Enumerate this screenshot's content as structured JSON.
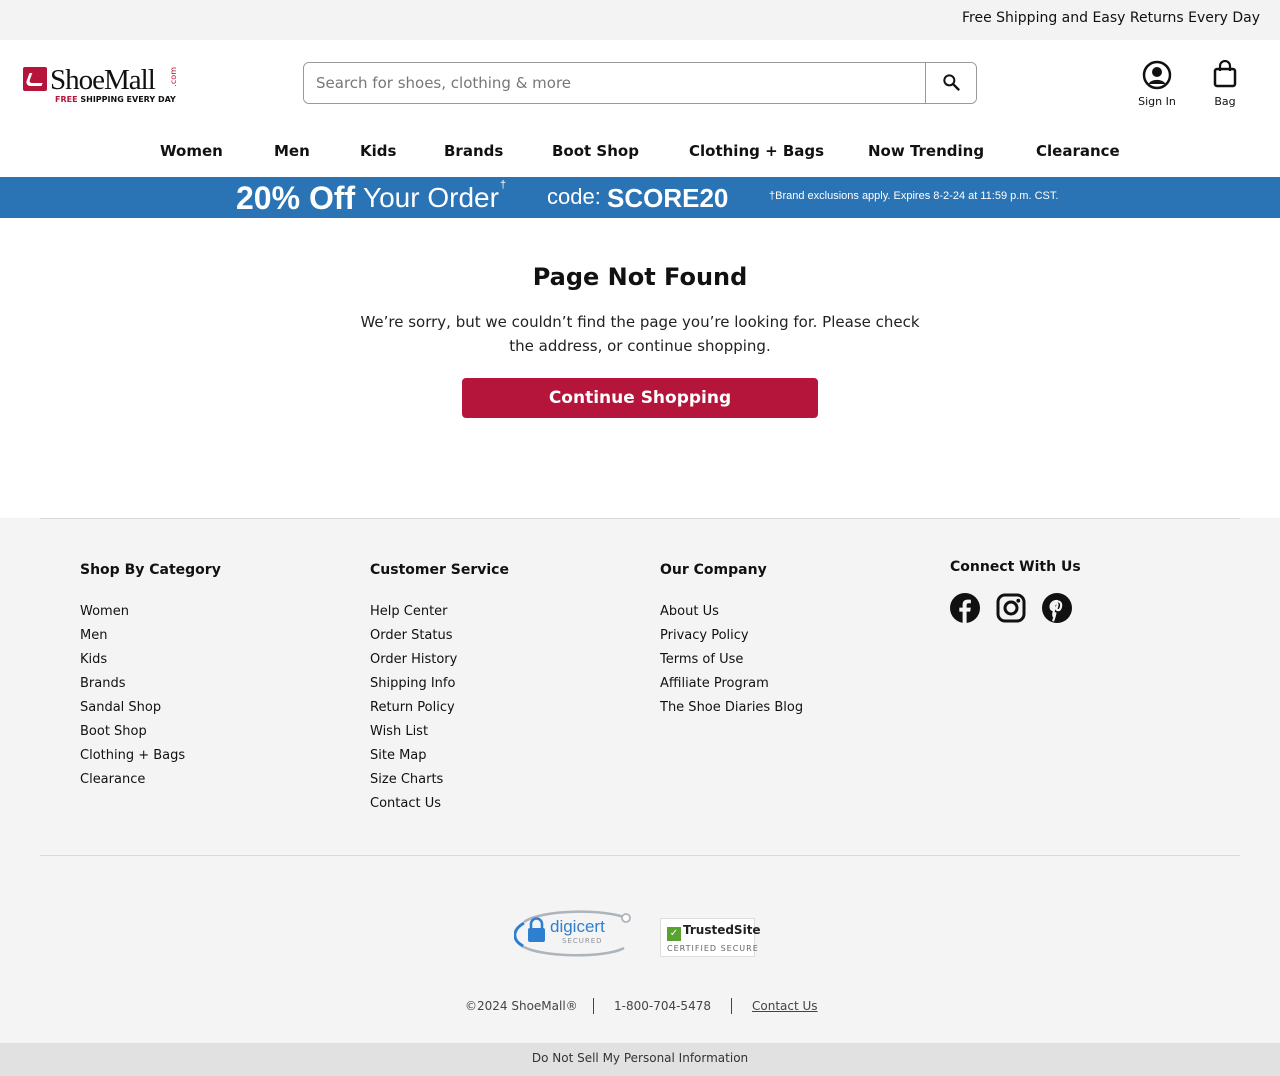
{
  "topbar": {
    "message": "Free Shipping and Easy Returns Every Day"
  },
  "brand": {
    "name": "ShoeMall",
    "tld": ".com",
    "tagline_free": "FREE",
    "tagline_rest": "SHIPPING EVERY DAY",
    "color": "#b5153a"
  },
  "search": {
    "placeholder": "Search for shoes, clothing & more",
    "value": ""
  },
  "account": {
    "sign_in": "Sign In",
    "bag": "Bag"
  },
  "nav": {
    "items": [
      {
        "label": "Women"
      },
      {
        "label": "Men"
      },
      {
        "label": "Kids"
      },
      {
        "label": "Brands"
      },
      {
        "label": "Boot Shop"
      },
      {
        "label": "Clothing + Bags"
      },
      {
        "label": "Now Trending"
      },
      {
        "label": "Clearance"
      }
    ]
  },
  "promo": {
    "headline": "20% Off",
    "subline": "Your Order",
    "dagger": "†",
    "code_label": "code:",
    "code": "SCORE20",
    "fine_print": "†Brand exclusions apply. Expires 8-2-24 at 11:59 p.m. CST.",
    "bg_color": "#2a73b4"
  },
  "not_found": {
    "title": "Page Not Found",
    "message": "We’re sorry, but we couldn’t find the page you’re looking for. Please check the address, or continue shopping.",
    "cta": "Continue Shopping"
  },
  "footer": {
    "shop": {
      "title": "Shop By Category",
      "links": [
        "Women",
        "Men",
        "Kids",
        "Brands",
        "Sandal Shop",
        "Boot Shop",
        "Clothing + Bags",
        "Clearance"
      ]
    },
    "service": {
      "title": "Customer Service",
      "links": [
        "Help Center",
        "Order Status",
        "Order History",
        "Shipping Info",
        "Return Policy",
        "Wish List",
        "Site Map",
        "Size Charts",
        "Contact Us"
      ]
    },
    "company": {
      "title": "Our Company",
      "links": [
        "About Us",
        "Privacy Policy",
        "Terms of Use",
        "Affiliate Program",
        "The Shoe Diaries Blog"
      ]
    },
    "connect": {
      "title": "Connect With Us",
      "icons": [
        "facebook-icon",
        "instagram-icon",
        "pinterest-icon"
      ]
    },
    "badges": {
      "digicert_name": "digicert",
      "digicert_sub": "SECURED",
      "trusted_name": "TrustedSite",
      "trusted_sub": "CERTIFIED SECURE"
    },
    "legal": {
      "copyright": "©2024 ShoeMall®",
      "phone": "1-800-704-5478",
      "contact": "Contact Us"
    },
    "do_not_sell": "Do Not Sell My Personal Information"
  }
}
